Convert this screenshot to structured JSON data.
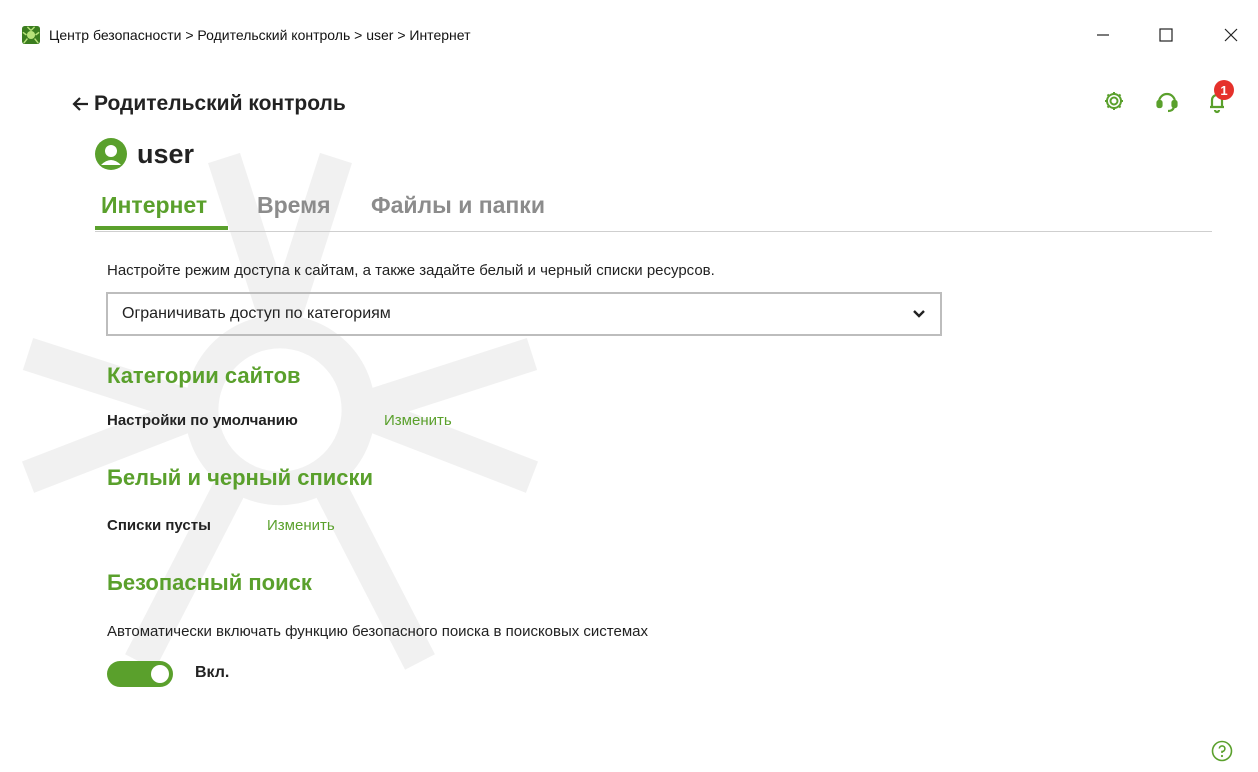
{
  "window": {
    "title": "Центр безопасности > Родительский контроль > user > Интернет",
    "minimize": "—",
    "maximize": "☐",
    "close": "✕"
  },
  "header": {
    "back_label": "Родительский контроль",
    "back_arrow": "🡐",
    "notifications_count": "1",
    "icons": [
      "gear-icon",
      "headset-icon",
      "bell-icon"
    ]
  },
  "user": {
    "name": "user"
  },
  "tabs": [
    {
      "label": "Интернет",
      "active": true
    },
    {
      "label": "Время",
      "active": false
    },
    {
      "label": "Файлы и папки",
      "active": false
    }
  ],
  "content": {
    "intro": "Настройте режим доступа к сайтам, а также задайте белый и черный списки ресурсов.",
    "access_mode": {
      "selected": "Ограничивать доступ по категориям"
    },
    "categories": {
      "title": "Категории сайтов",
      "status": "Настройки по умолчанию",
      "link": "Изменить"
    },
    "lists": {
      "title": "Белый и черный списки",
      "status": "Списки пусты",
      "link": "Изменить"
    },
    "safe_search": {
      "title": "Безопасный поиск",
      "description": "Автоматически включать функцию безопасного поиска в поисковых системах",
      "toggle_state": true,
      "toggle_label": "Вкл."
    }
  },
  "colors": {
    "accent": "#5aa02c",
    "badge": "#e5312b",
    "text": "#222222",
    "inactive_tab": "#8c8c8c"
  }
}
